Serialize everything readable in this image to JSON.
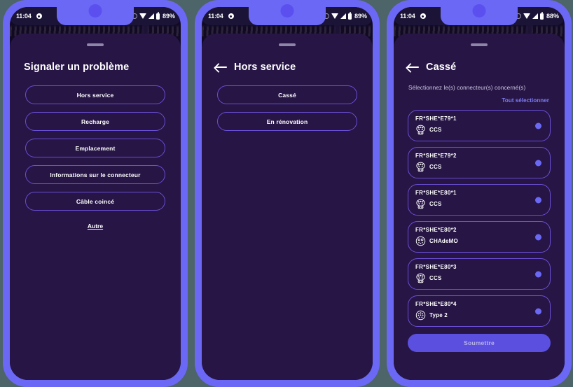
{
  "status_bar": {
    "time": "11:04",
    "alarm_icon": "alarm-icon",
    "mute_icon": "mute-icon",
    "wifi_icon": "wifi-icon",
    "signal_icon": "signal-icon",
    "battery_icon": "battery-icon",
    "battery_1": "89%",
    "battery_2": "89%",
    "battery_3": "88%"
  },
  "screen1": {
    "title": "Signaler un problème",
    "options": [
      {
        "label": "Hors service"
      },
      {
        "label": "Recharge"
      },
      {
        "label": "Emplacement"
      },
      {
        "label": "Informations sur le connecteur"
      },
      {
        "label": "Câble coincé"
      }
    ],
    "other_link": "Autre"
  },
  "screen2": {
    "back_icon": "back-arrow-icon",
    "title": "Hors service",
    "options": [
      {
        "label": "Cassé"
      },
      {
        "label": "En rénovation"
      }
    ]
  },
  "screen3": {
    "back_icon": "back-arrow-icon",
    "title": "Cassé",
    "hint": "Sélectionnez le(s) connecteur(s) concerné(s)",
    "select_all": "Tout sélectionner",
    "connectors": [
      {
        "id": "FR*SHE*E79*1",
        "type": "CCS",
        "icon": "ccs-plug-icon",
        "selected": true
      },
      {
        "id": "FR*SHE*E79*2",
        "type": "CCS",
        "icon": "ccs-plug-icon",
        "selected": true
      },
      {
        "id": "FR*SHE*E80*1",
        "type": "CCS",
        "icon": "ccs-plug-icon",
        "selected": true
      },
      {
        "id": "FR*SHE*E80*2",
        "type": "CHAdeMO",
        "icon": "chademo-plug-icon",
        "selected": true
      },
      {
        "id": "FR*SHE*E80*3",
        "type": "CCS",
        "icon": "ccs-plug-icon",
        "selected": true
      },
      {
        "id": "FR*SHE*E80*4",
        "type": "Type 2",
        "icon": "type2-plug-icon",
        "selected": true
      }
    ],
    "submit_label": "Soumettre"
  },
  "colors": {
    "bezel": "#6b68f5",
    "sheet": "#261545",
    "outline": "#6a4fd6",
    "accent": "#5b4fe0",
    "link": "#7d7bf2",
    "page_bg": "#4d6468"
  }
}
